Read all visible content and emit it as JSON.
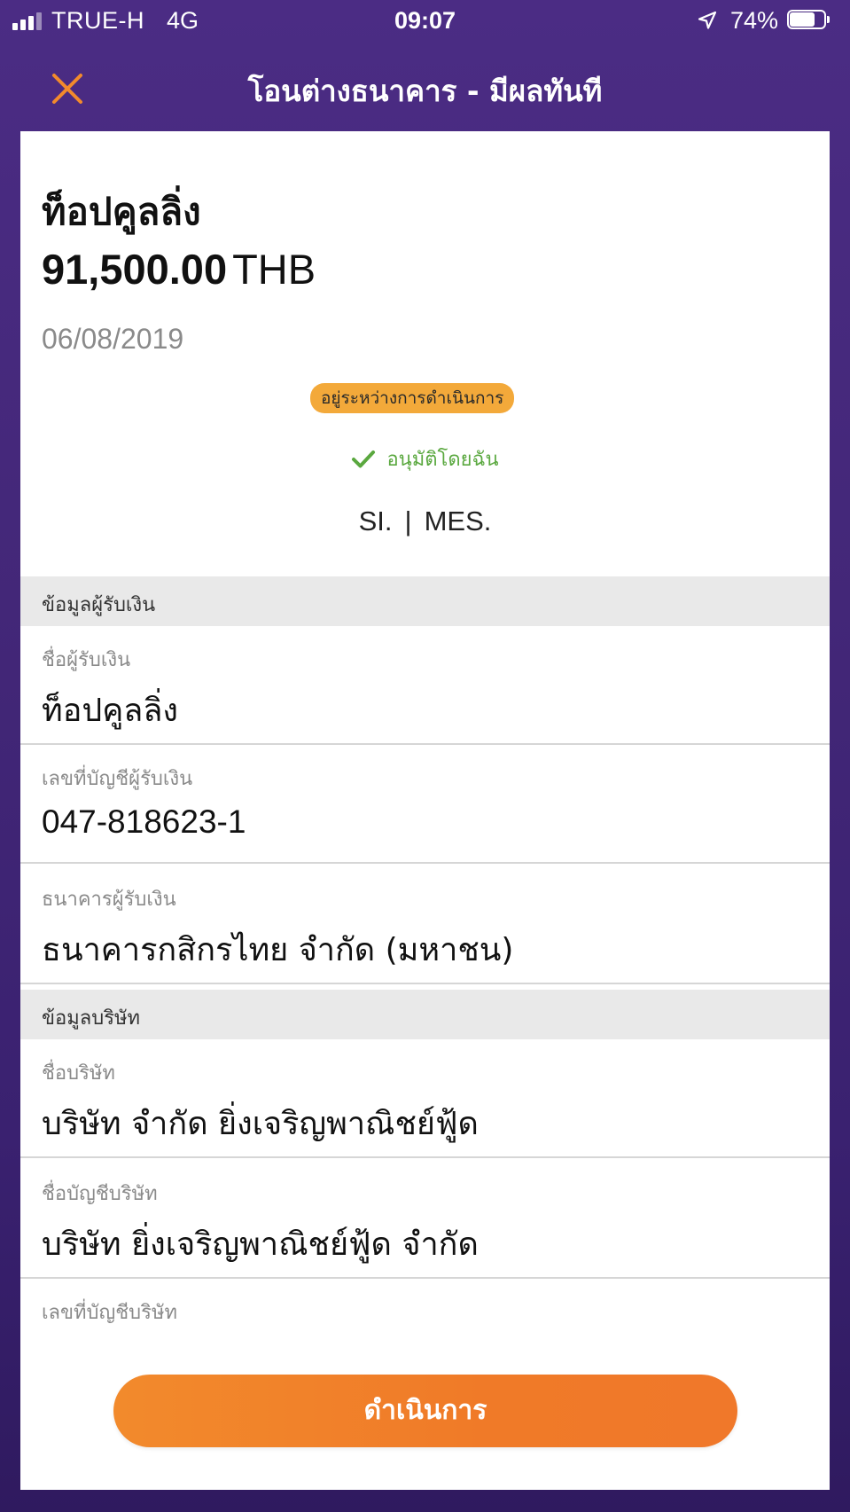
{
  "status_bar": {
    "carrier": "TRUE-H",
    "network": "4G",
    "time": "09:07",
    "battery": "74%",
    "icons": [
      "signal-icon",
      "location-arrow-icon",
      "battery-icon"
    ]
  },
  "nav": {
    "title": "โอนต่างธนาคาร - มีผลทันที",
    "close_icon": "close-icon",
    "accent_color": "#f28a2c"
  },
  "summary": {
    "payee_name": "ท็อปคูลลิ่ง",
    "amount": "91,500.00",
    "currency": "THB",
    "date": "06/08/2019",
    "status": "อยู่ระหว่างการดำเนินการ",
    "approval": "อนุมัติโดยฉัน",
    "approval_icon": "check-icon",
    "reference_left": "SI.",
    "reference_separator": "|",
    "reference_right": "MES."
  },
  "payee_section": {
    "header": "ข้อมูลผู้รับเงิน",
    "fields": [
      {
        "label": "ชื่อผู้รับเงิน",
        "value": "ท็อปคูลลิ่ง"
      },
      {
        "label": "เลขที่บัญชีผู้รับเงิน",
        "value": "047-818623-1"
      },
      {
        "label": "ธนาคารผู้รับเงิน",
        "value": "ธนาคารกสิกรไทย จำกัด (มหาชน)"
      }
    ]
  },
  "company_section": {
    "header": "ข้อมูลบริษัท",
    "fields": [
      {
        "label": "ชื่อบริษัท",
        "value": "บริษัท จำกัด ยิ่งเจริญพาณิชย์ฟู้ด"
      },
      {
        "label": "ชื่อบัญชีบริษัท",
        "value": "บริษัท ยิ่งเจริญพาณิชย์ฟู้ด จำกัด"
      },
      {
        "label": "เลขที่บัญชีบริษัท",
        "value": ""
      }
    ]
  },
  "actions": {
    "proceed_label": "ดำเนินการ"
  },
  "colors": {
    "header_purple": "#4b2c84",
    "badge_orange": "#f3a93a",
    "approval_green": "#5aa83f",
    "button_orange": "#f28a2c"
  }
}
